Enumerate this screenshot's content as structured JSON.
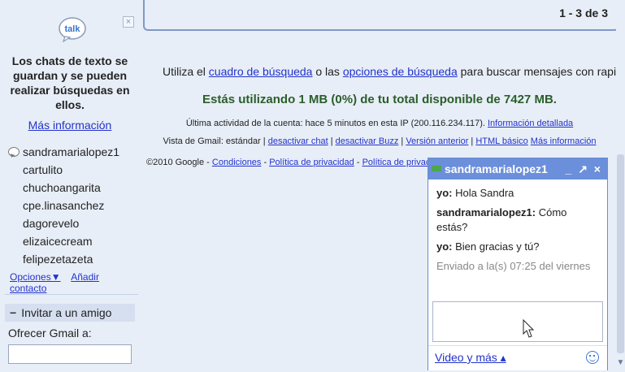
{
  "talk": {
    "logo_text": "talk",
    "close_label": "×",
    "message": "Los chats de texto se guardan y se pueden realizar búsquedas en ellos.",
    "more_info": "Más información"
  },
  "contacts": [
    "sandramarialopez1",
    "cartulito",
    "chuchoangarita",
    "cpe.linasanchez",
    "dagorevelo",
    "elizaicecream",
    "felipezetazeta"
  ],
  "contacts_options": {
    "options": "Opciones▼",
    "add": "Añadir contacto"
  },
  "invite": {
    "toggle": "−",
    "title": "Invitar a un amigo",
    "label": "Ofrecer Gmail a:",
    "value": ""
  },
  "pager": "1 - 3 de 3",
  "search_info": {
    "pre": "Utiliza el ",
    "link1": "cuadro de búsqueda",
    "mid": " o las ",
    "link2": "opciones de búsqueda",
    "post": " para buscar mensajes con rapidez."
  },
  "storage": "Estás utilizando 1 MB (0%) de tu total disponible de 7427 MB.",
  "activity": {
    "text": "Última actividad de la cuenta: hace 5 minutos en esta IP (200.116.234.117).",
    "link": "Información detallada"
  },
  "view": {
    "label": "Vista de Gmail: estándar | ",
    "l1": "desactivar chat",
    "s1": " | ",
    "l2": "desactivar Buzz",
    "s2": " | ",
    "l3": "Versión anterior",
    "s3": " | ",
    "l4": "HTML básico",
    "s4": "  ",
    "l5": "Más información"
  },
  "footer": {
    "copy": "©2010 Google - ",
    "l1": "Condiciones",
    "s1": " - ",
    "l2": "Política de privacidad",
    "s2": " - ",
    "l3": "Política de privacid"
  },
  "chat": {
    "name": "sandramarialopez1",
    "controls": "_ ↗ ×",
    "messages": [
      {
        "who": "yo:",
        "text": "Hola Sandra"
      },
      {
        "who": "sandramarialopez1:",
        "text": "Cómo estás?"
      },
      {
        "who": "yo:",
        "text": "Bien gracias y tú?"
      }
    ],
    "sent": "Enviado a la(s) 07:25 del viernes",
    "compose_value": "",
    "video": "Video y más ▴"
  },
  "colors": {
    "accent": "#6b8fdb",
    "link": "#2233cc",
    "storage_green": "#2a5e2a",
    "background": "#e8eef7"
  }
}
